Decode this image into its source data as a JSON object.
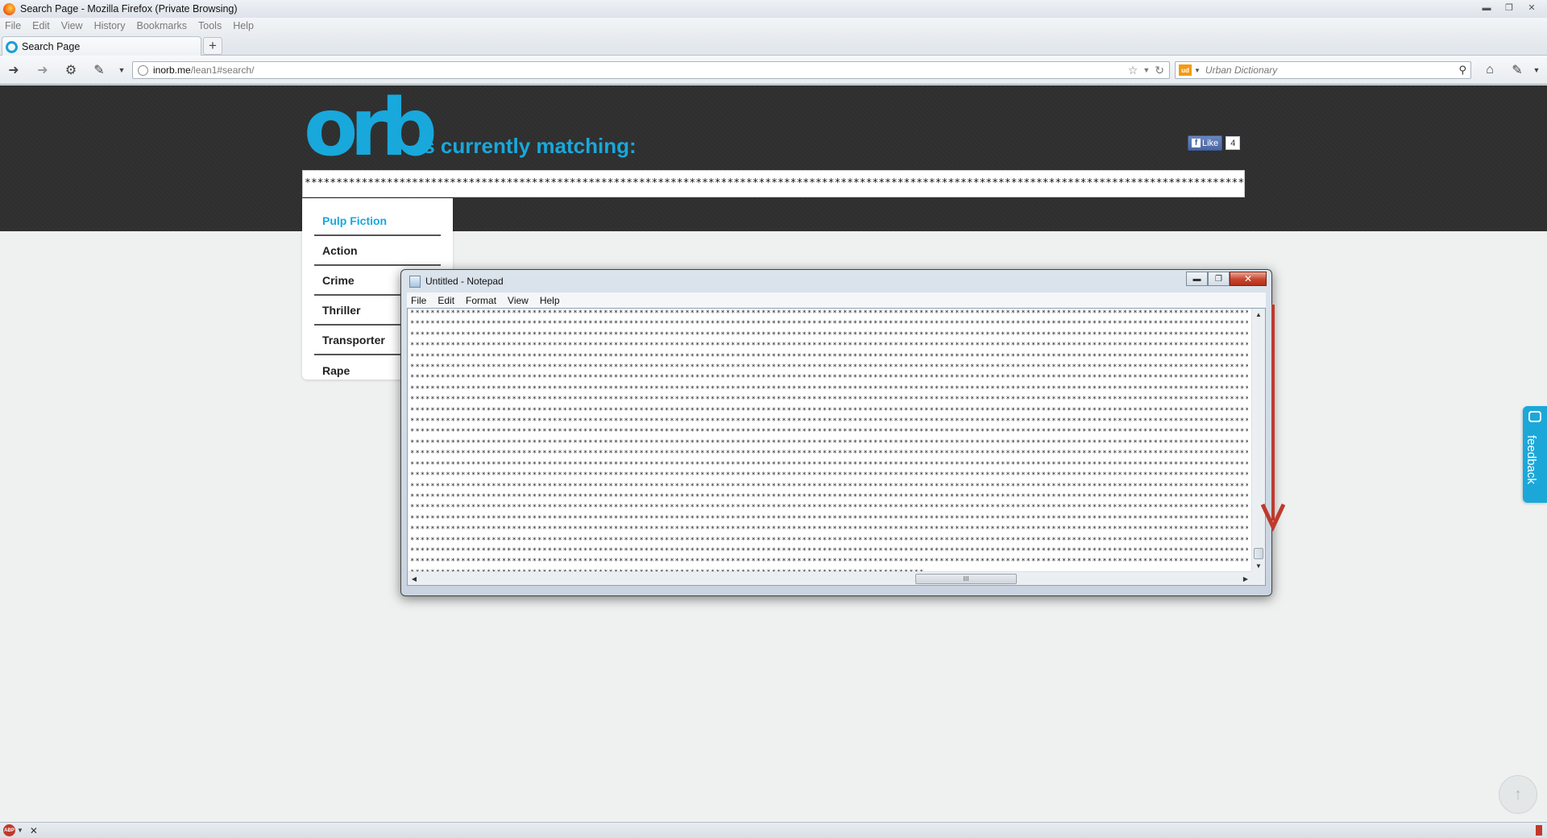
{
  "window": {
    "title": "Search Page - Mozilla Firefox (Private Browsing)",
    "controls": [
      "minimize",
      "restore",
      "close"
    ]
  },
  "menubar": {
    "items": [
      "File",
      "Edit",
      "View",
      "History",
      "Bookmarks",
      "Tools",
      "Help"
    ]
  },
  "tabs": [
    {
      "title": "Search Page",
      "active": true
    }
  ],
  "navbar": {
    "url_host": "inorb.me",
    "url_path": "/lean1#search/",
    "search_engine": "ud",
    "search_placeholder": "Urban Dictionary"
  },
  "page": {
    "logo": "orb",
    "heading": "is currently matching:",
    "fb_like_label": "Like",
    "fb_like_count": "4",
    "query_value": "*************************************************************************************************************************************************************************************************",
    "genres": [
      {
        "label": "Pulp Fiction",
        "active": true
      },
      {
        "label": "Action",
        "active": false
      },
      {
        "label": "Crime",
        "active": false
      },
      {
        "label": "Thriller",
        "active": false
      },
      {
        "label": "Transporter",
        "active": false
      },
      {
        "label": "Rape",
        "active": false
      }
    ],
    "feedback_label": "feedback",
    "accent_color": "#18a8dc",
    "header_bg": "#2e2e2e"
  },
  "notepad": {
    "title": "Untitled - Notepad",
    "menu": [
      "File",
      "Edit",
      "Format",
      "View",
      "Help"
    ],
    "line_char": "*",
    "full_line_count": 24,
    "last_line": "*****************************************************************************************************",
    "hscroll_grip": "III"
  },
  "annotation": {
    "arrow_color": "#c0392b",
    "arrow_direction": "down"
  },
  "addon_bar": {
    "abp_label": "ABP"
  }
}
